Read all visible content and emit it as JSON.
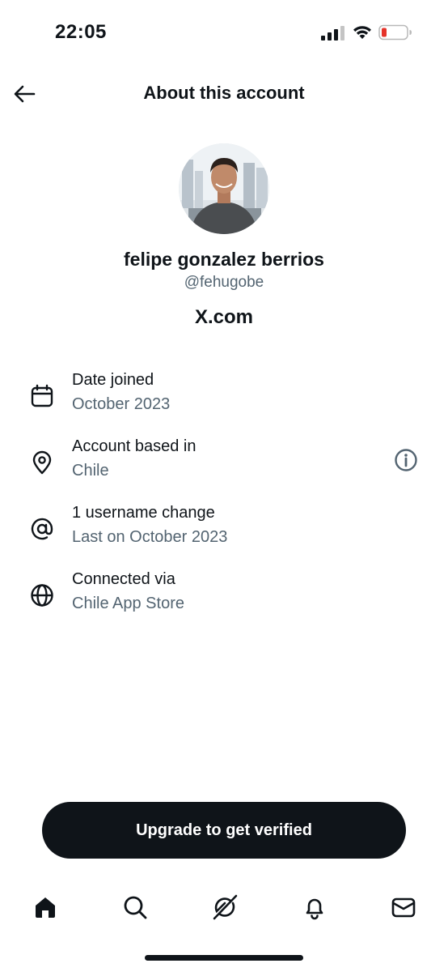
{
  "status_bar": {
    "time": "22:05",
    "battery_color": "#e5332a"
  },
  "header": {
    "title": "About this account"
  },
  "profile": {
    "name": "felipe gonzalez berrios",
    "handle": "@fehugobe",
    "source_label": "X.com"
  },
  "info_rows": [
    {
      "icon": "calendar-icon",
      "label": "Date joined",
      "value": "October 2023"
    },
    {
      "icon": "location-pin-icon",
      "label": "Account based in",
      "value": "Chile"
    },
    {
      "icon": "at-sign-icon",
      "label": "1 username change",
      "value": "Last on October 2023"
    },
    {
      "icon": "globe-icon",
      "label": "Connected via",
      "value": "Chile App Store"
    }
  ],
  "upgrade_button": {
    "label": "Upgrade to get verified"
  },
  "tab_bar": {
    "tabs": [
      "home-icon",
      "search-icon",
      "grok-icon",
      "notifications-bell-icon",
      "messages-envelope-icon"
    ]
  },
  "colors": {
    "text_primary": "#0f1419",
    "text_secondary": "#536471",
    "button_bg": "#0f1419"
  }
}
